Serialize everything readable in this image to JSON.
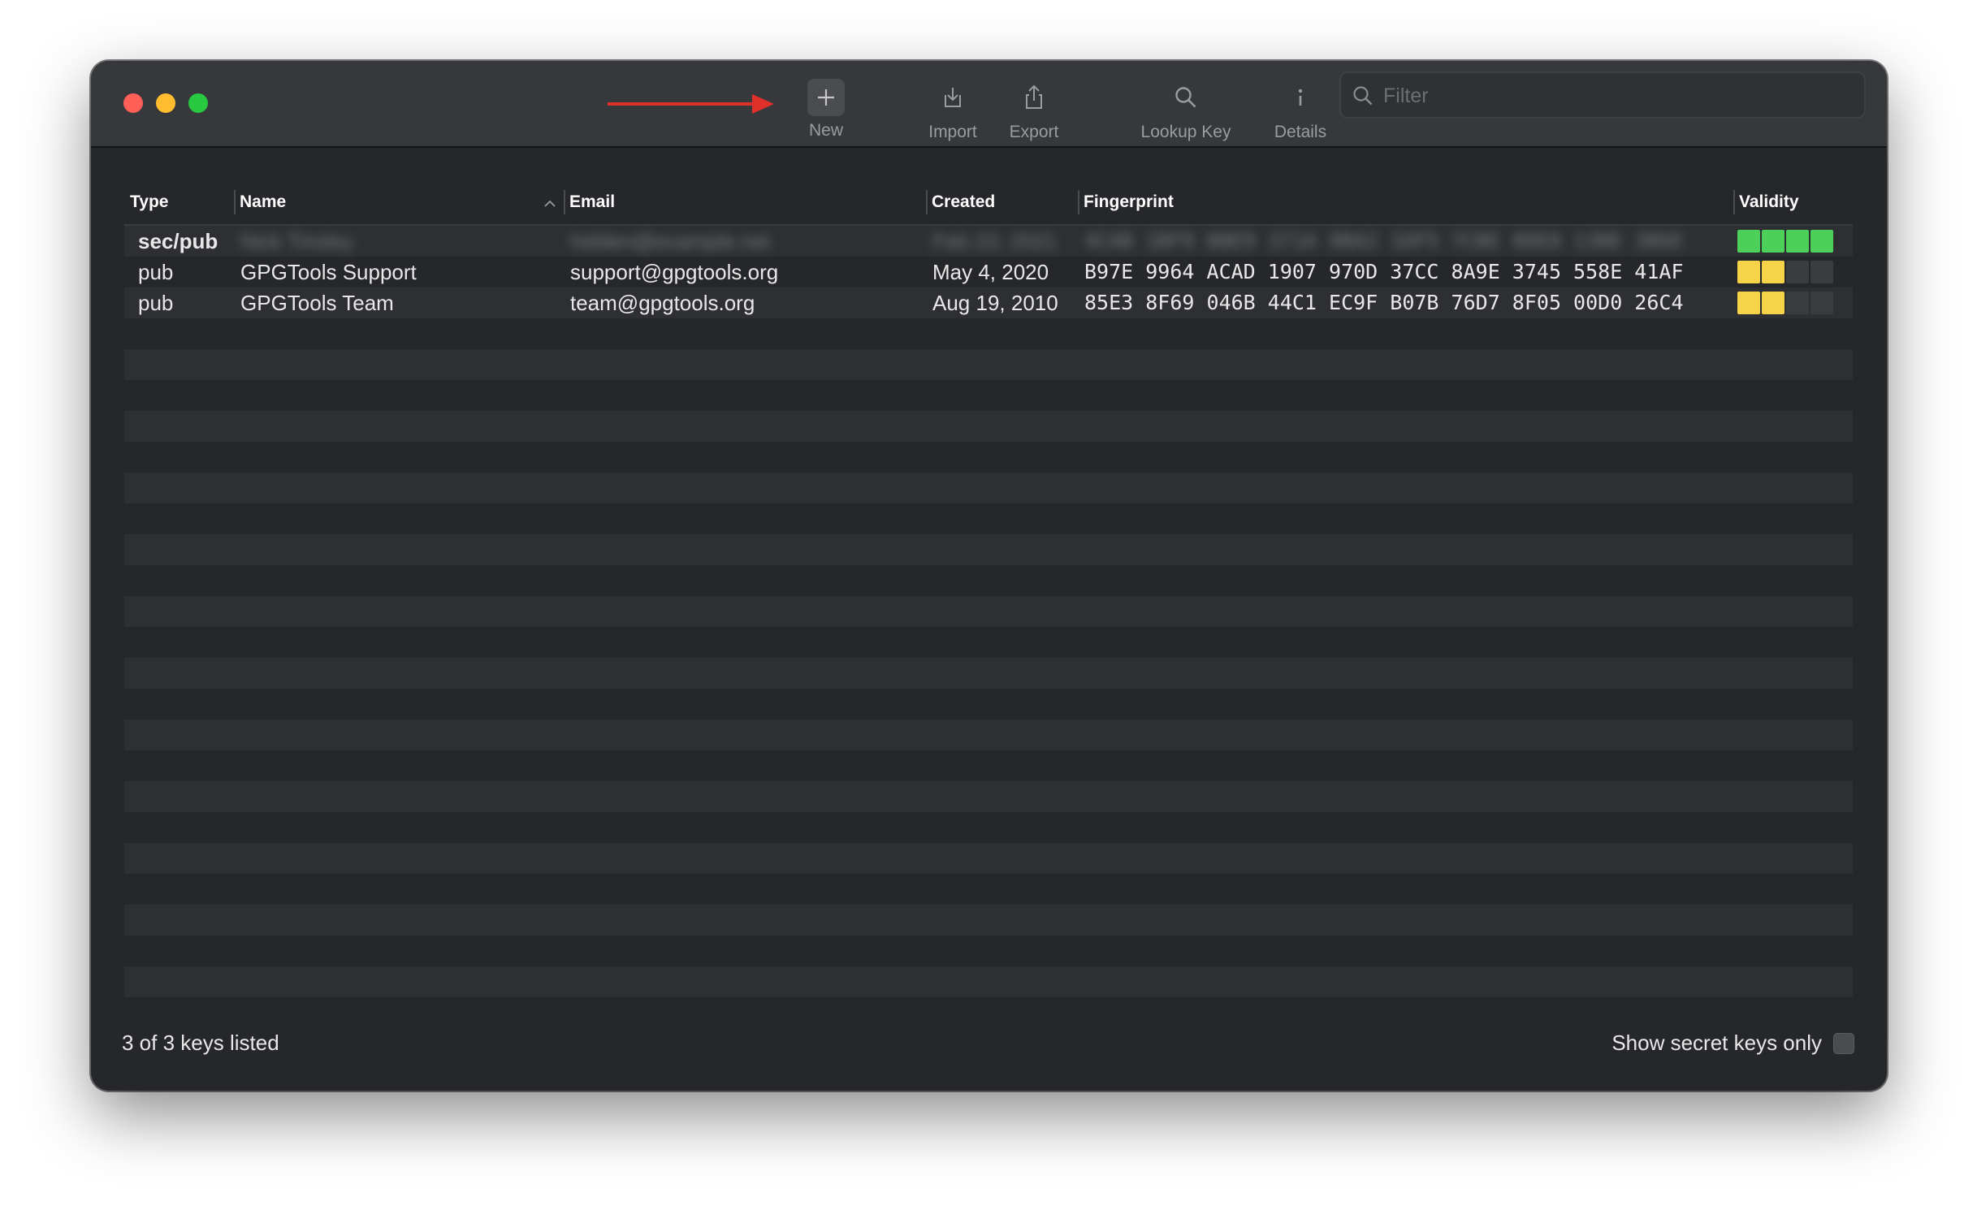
{
  "toolbar": {
    "new_label": "New",
    "import_label": "Import",
    "export_label": "Export",
    "lookup_label": "Lookup Key",
    "details_label": "Details",
    "filter_placeholder": "Filter"
  },
  "columns": {
    "type": "Type",
    "name": "Name",
    "email": "Email",
    "created": "Created",
    "fingerprint": "Fingerprint",
    "validity": "Validity"
  },
  "keys": [
    {
      "type": "sec/pub",
      "name": "Nick Tinsley",
      "email": "hidden@example.net",
      "created": "Feb 23, 2021",
      "fingerprint": "4CAB 1BF9 8BE9 371A 9BA2   1DF5 7CBE 0DE8 13BE 3B6E",
      "validity": [
        "green",
        "green",
        "green",
        "green"
      ],
      "redacted": true
    },
    {
      "type": "pub",
      "name": "GPGTools Support",
      "email": "support@gpgtools.org",
      "created": "May 4, 2020",
      "fingerprint": "B97E 9964 ACAD 1907 970D   37CC 8A9E 3745 558E 41AF",
      "validity": [
        "yellow",
        "yellow",
        "empty",
        "empty"
      ],
      "redacted": false
    },
    {
      "type": "pub",
      "name": "GPGTools Team",
      "email": "team@gpgtools.org",
      "created": "Aug 19, 2010",
      "fingerprint": "85E3 8F69 046B 44C1 EC9F   B07B 76D7 8F05 00D0 26C4",
      "validity": [
        "yellow",
        "yellow",
        "empty",
        "empty"
      ],
      "redacted": false
    }
  ],
  "footer": {
    "count_text": "3 of 3 keys listed",
    "secret_only_label": "Show secret keys only"
  },
  "colors": {
    "annotation_arrow": "#e0302a",
    "validity_full": "#4cd05a",
    "validity_marginal": "#f7d34a"
  }
}
